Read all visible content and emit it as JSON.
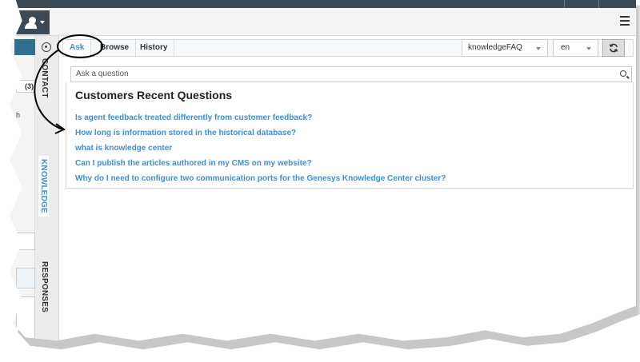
{
  "header": {
    "user_icon": "user-icon",
    "menu_icon": "hamburger-icon"
  },
  "left_partial": {
    "count_text": "(3)",
    "char_text": "h"
  },
  "side_tabs": {
    "contact": "CONTACT",
    "knowledge": "KNOWLEDGE",
    "responses": "RESPONSES"
  },
  "tabs": {
    "ask": "Ask",
    "browse": "Browse",
    "history": "History"
  },
  "knowledge_base": {
    "selected": "knowledgeFAQ"
  },
  "language": {
    "selected": "en"
  },
  "search": {
    "placeholder": "Ask a question"
  },
  "recent": {
    "title": "Customers Recent Questions",
    "questions": [
      "Is agent feedback treated differently from customer feedback?",
      "How long is information stored in the historical database?",
      "what is knowledge center",
      "Can I publish the articles authored in my CMS on my website?",
      "Why do I need to configure two communication ports for the Genesys Knowledge Center cluster?"
    ]
  },
  "colors": {
    "accent": "#3d8fd8",
    "topbar": "#3c4a55"
  }
}
